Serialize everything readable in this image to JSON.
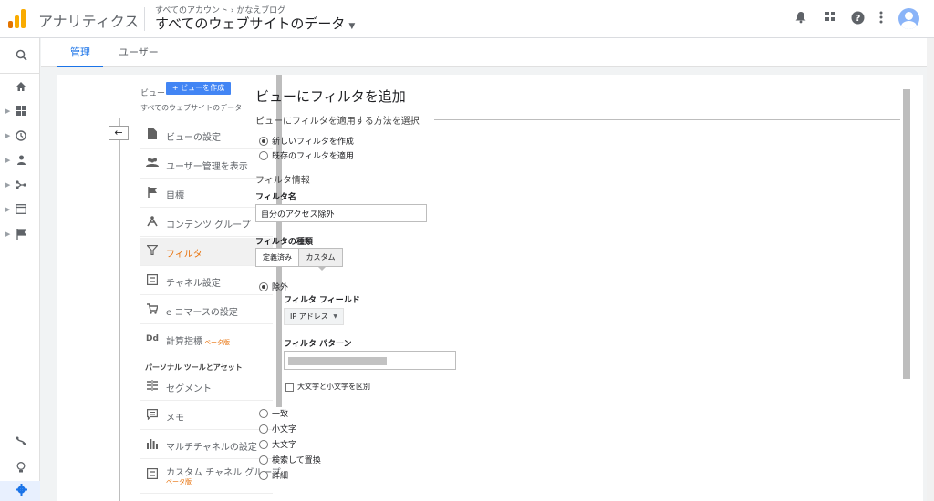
{
  "header": {
    "app_name": "アナリティクス",
    "breadcrumb": "すべてのアカウント › かなえブログ",
    "property_title": "すべてのウェブサイトのデータ",
    "icons": [
      "bell-icon",
      "apps-grid-icon",
      "help-icon",
      "more-vert-icon",
      "account-avatar-icon"
    ],
    "logo_colors": [
      "#f9ab00",
      "#e37400"
    ]
  },
  "rail": {
    "items": [
      "search-icon",
      "home-icon",
      "customization-icon",
      "realtime-icon",
      "audience-icon",
      "acquisition-icon",
      "behavior-icon",
      "conversions-icon",
      "attribution-icon",
      "discover-icon",
      "admin-gear-icon"
    ]
  },
  "tabs": [
    "管理",
    "ユーザー"
  ],
  "view_nav": {
    "view_label": "ビュー",
    "create_view": "+ ビューを作成",
    "view_name": "すべてのウェブサイトのデータ",
    "items": [
      {
        "label": "ビューの設定",
        "icon": "document-icon"
      },
      {
        "label": "ユーザー管理を表示",
        "icon": "users-icon"
      },
      {
        "label": "目標",
        "icon": "flag-icon"
      },
      {
        "label": "コンテンツ グループ",
        "icon": "content-group-icon"
      },
      {
        "label": "フィルタ",
        "icon": "filter-icon",
        "active": true
      },
      {
        "label": "チャネル設定",
        "icon": "channel-icon"
      },
      {
        "label": "e コマースの設定",
        "icon": "cart-icon"
      },
      {
        "label": "計算指標",
        "beta": "ベータ版",
        "icon": "dd-icon"
      }
    ],
    "section_title": "パーソナル ツールとアセット",
    "personal_items": [
      {
        "label": "セグメント",
        "icon": "segment-icon"
      },
      {
        "label": "メモ",
        "icon": "note-icon"
      },
      {
        "label": "マルチチャネルの設定",
        "icon": "bar-chart-icon"
      },
      {
        "label": "カスタム チャネル グループ",
        "beta": "ベータ版",
        "icon": "custom-channel-icon"
      }
    ]
  },
  "form": {
    "title": "ビューにフィルタを追加",
    "method_legend": "ビューにフィルタを適用する方法を選択",
    "method_options": [
      "新しいフィルタを作成",
      "既存のフィルタを適用"
    ],
    "info_legend": "フィルタ情報",
    "filter_name_label": "フィルタ名",
    "filter_name_value": "自分のアクセス除外",
    "filter_type_label": "フィルタの種類",
    "type_buttons": [
      "定義済み",
      "カスタム"
    ],
    "custom_options": [
      "除外",
      "一致",
      "小文字",
      "大文字",
      "検索して置換",
      "詳細"
    ],
    "field_label": "フィルタ フィールド",
    "field_value": "IP アドレス",
    "pattern_label": "フィルタ パターン",
    "case_sensitive_label": "大文字と小文字を区別"
  }
}
